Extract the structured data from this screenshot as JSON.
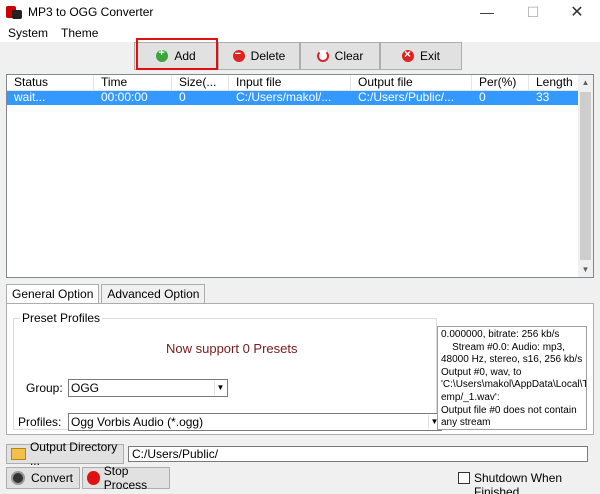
{
  "window": {
    "title": "MP3 to OGG Converter"
  },
  "menu": [
    "System",
    "Theme"
  ],
  "toolbar": {
    "add": "Add",
    "delete": "Delete",
    "clear": "Clear",
    "exit": "Exit"
  },
  "list": {
    "columns": [
      "Status",
      "Time",
      "Size(...",
      "Input file",
      "Output file",
      "Per(%)",
      "Length"
    ],
    "rows": [
      [
        "wait...",
        "00:00:00",
        "0",
        "C:/Users/makol/...",
        "C:/Users/Public/...",
        "0",
        "33"
      ]
    ]
  },
  "tabs": {
    "general": "General Option",
    "advanced": "Advanced Option"
  },
  "preset": {
    "legend": "Preset Profiles",
    "support": "Now support 0 Presets",
    "group_label": "Group:",
    "group_value": "OGG",
    "profiles_label": "Profiles:",
    "profiles_value": "Ogg Vorbis Audio (*.ogg)"
  },
  "log": [
    "0.000000, bitrate: 256 kb/s",
    "    Stream #0.0: Audio: mp3,",
    "48000 Hz, stereo, s16, 256 kb/s",
    "Output #0, wav, to",
    "'C:\\Users\\makol\\AppData\\Local\\T",
    "emp/_1.wav':",
    "Output file #0 does not contain",
    "any stream"
  ],
  "output": {
    "button": "Output Directory ...",
    "path": "C:/Users/Public/"
  },
  "bottom": {
    "convert": "Convert",
    "stop": "Stop Process",
    "shutdown": "Shutdown When Finished"
  }
}
